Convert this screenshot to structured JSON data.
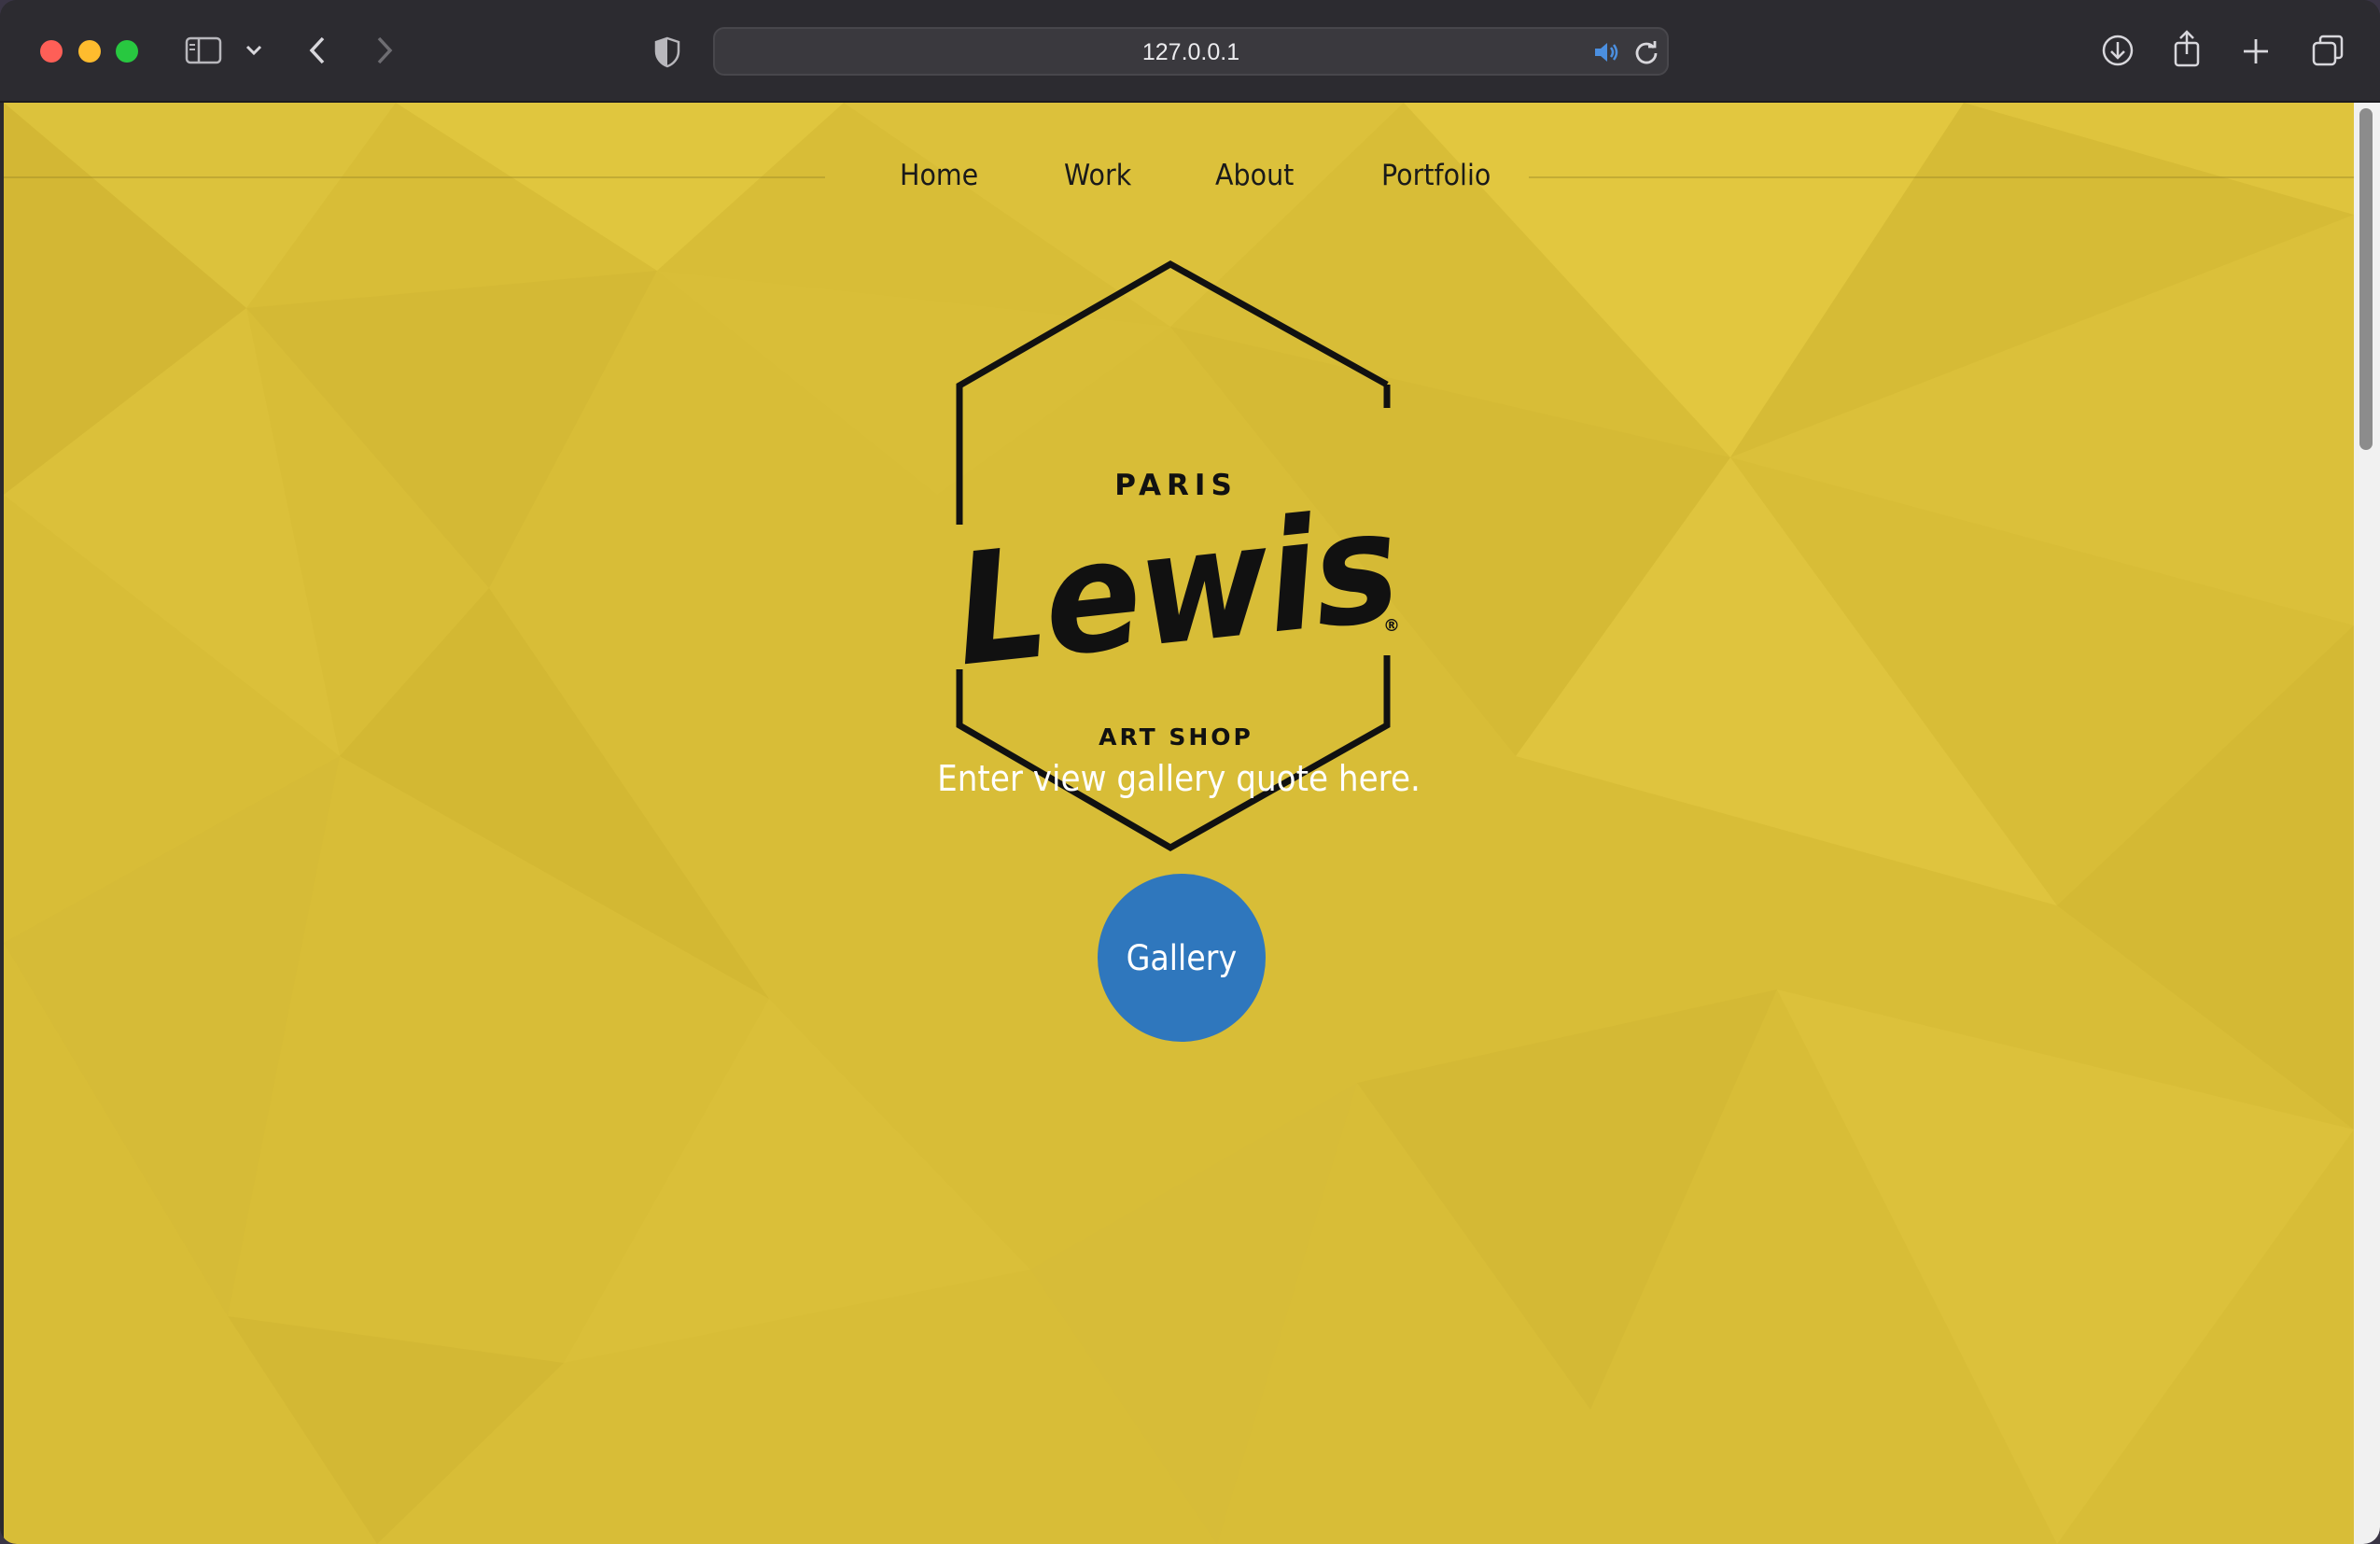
{
  "browser": {
    "url": "127.0.0.1",
    "icons": [
      "sidebar-icon",
      "chevron-down-icon",
      "back-icon",
      "forward-icon",
      "privacy-shield-icon",
      "audio-playing-icon",
      "reload-icon",
      "download-icon",
      "share-icon",
      "new-tab-icon",
      "tab-overview-icon"
    ]
  },
  "nav": {
    "items": [
      {
        "label": "Home"
      },
      {
        "label": "Work"
      },
      {
        "label": "About"
      },
      {
        "label": "Portfolio"
      }
    ]
  },
  "logo": {
    "top_text": "PARIS",
    "main_text": "Lewis",
    "registered": "®",
    "bottom_text": "ART SHOP"
  },
  "hero": {
    "quote": "Enter view gallery quote here.",
    "button_label": "Gallery"
  },
  "colors": {
    "page_background": "#d8bd37",
    "button": "#2f77bd",
    "quote_text": "#ffffff"
  }
}
